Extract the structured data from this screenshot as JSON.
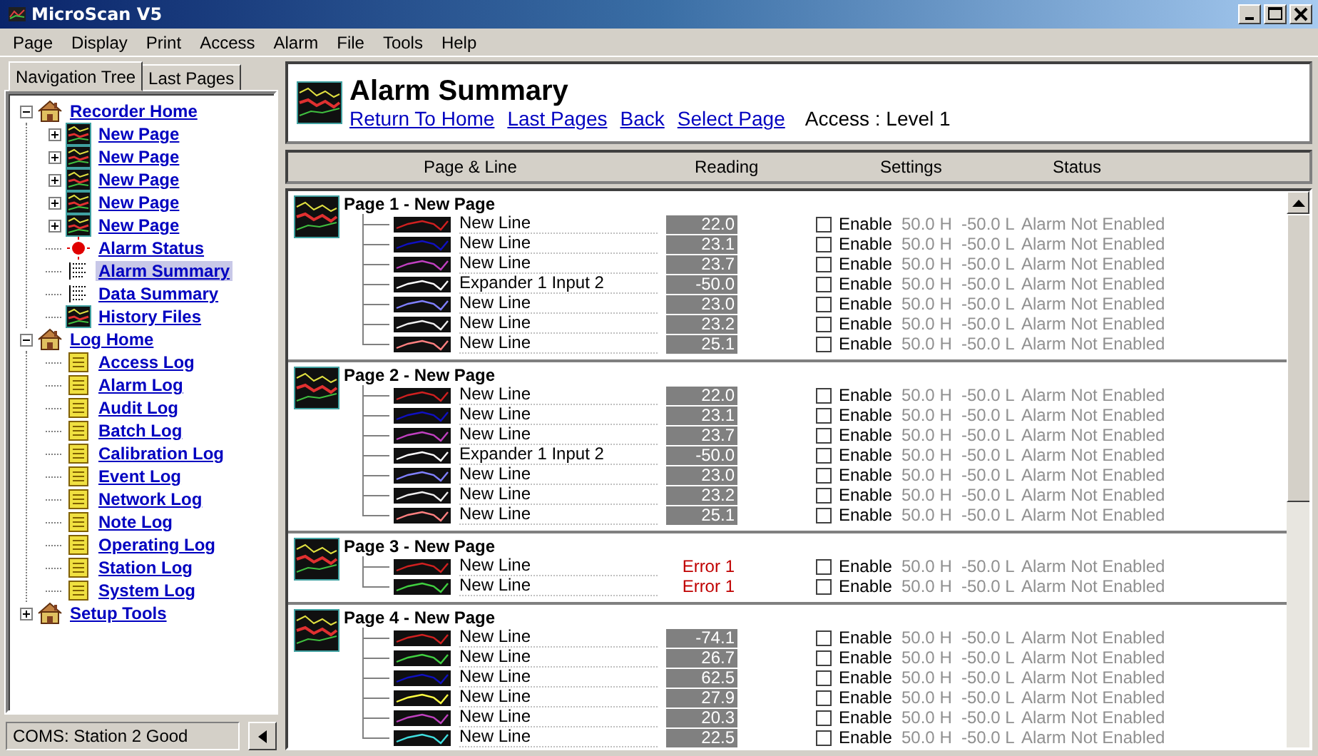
{
  "window": {
    "title": "MicroScan V5"
  },
  "menu": [
    "Page",
    "Display",
    "Print",
    "Access",
    "Alarm",
    "File",
    "Tools",
    "Help"
  ],
  "nav_tabs": [
    {
      "label": "Navigation Tree",
      "selected": true
    },
    {
      "label": "Last Pages",
      "selected": false
    }
  ],
  "tree": [
    {
      "label": "Recorder Home",
      "kind": "home",
      "expanded": true,
      "selected": false,
      "children": [
        {
          "label": "New Page",
          "kind": "page",
          "expanded": false,
          "selected": false
        },
        {
          "label": "New Page",
          "kind": "page",
          "expanded": false,
          "selected": false
        },
        {
          "label": "New Page",
          "kind": "page",
          "expanded": false,
          "selected": false
        },
        {
          "label": "New Page",
          "kind": "page",
          "expanded": false,
          "selected": false
        },
        {
          "label": "New Page",
          "kind": "page",
          "expanded": false,
          "selected": false
        },
        {
          "label": "Alarm Status",
          "kind": "alarm",
          "selected": false
        },
        {
          "label": "Alarm Summary",
          "kind": "summary",
          "selected": true
        },
        {
          "label": "Data Summary",
          "kind": "summary",
          "selected": false
        },
        {
          "label": "History Files",
          "kind": "page",
          "selected": false
        }
      ]
    },
    {
      "label": "Log Home",
      "kind": "home",
      "expanded": true,
      "selected": false,
      "children": [
        {
          "label": "Access Log",
          "kind": "log",
          "selected": false
        },
        {
          "label": "Alarm Log",
          "kind": "log",
          "selected": false
        },
        {
          "label": "Audit Log",
          "kind": "log",
          "selected": false
        },
        {
          "label": "Batch Log",
          "kind": "log",
          "selected": false
        },
        {
          "label": "Calibration Log",
          "kind": "log",
          "selected": false
        },
        {
          "label": "Event Log",
          "kind": "log",
          "selected": false
        },
        {
          "label": "Network Log",
          "kind": "log",
          "selected": false
        },
        {
          "label": "Note Log",
          "kind": "log",
          "selected": false
        },
        {
          "label": "Operating Log",
          "kind": "log",
          "selected": false
        },
        {
          "label": "Station Log",
          "kind": "log",
          "selected": false
        },
        {
          "label": "System Log",
          "kind": "log",
          "selected": false
        }
      ]
    },
    {
      "label": "Setup Tools",
      "kind": "home",
      "expanded": false,
      "selected": false
    }
  ],
  "status_bar": {
    "text": "COMS: Station 2 Good"
  },
  "header": {
    "title": "Alarm Summary",
    "links": [
      "Return To Home",
      "Last Pages",
      "Back",
      "Select Page"
    ],
    "access": "Access : Level 1"
  },
  "columns": [
    "Page & Line",
    "Reading",
    "Settings",
    "Status"
  ],
  "groups": [
    {
      "title": "Page 1 - New Page",
      "lines": [
        {
          "name": "New Line",
          "color": "#d02020",
          "kind": "value",
          "reading": "22.0",
          "enable": "Enable",
          "checked": false,
          "high": "50.0 H",
          "low": "-50.0 L",
          "status": "Alarm Not Enabled"
        },
        {
          "name": "New Line",
          "color": "#1010c0",
          "kind": "value",
          "reading": "23.1",
          "enable": "Enable",
          "checked": false,
          "high": "50.0 H",
          "low": "-50.0 L",
          "status": "Alarm Not Enabled"
        },
        {
          "name": "New Line",
          "color": "#c040c0",
          "kind": "value",
          "reading": "23.7",
          "enable": "Enable",
          "checked": false,
          "high": "50.0 H",
          "low": "-50.0 L",
          "status": "Alarm Not Enabled"
        },
        {
          "name": "Expander 1 Input 2",
          "color": "#ffffff",
          "kind": "value",
          "reading": "-50.0",
          "enable": "Enable",
          "checked": false,
          "high": "50.0 H",
          "low": "-50.0 L",
          "status": "Alarm Not Enabled"
        },
        {
          "name": "New Line",
          "color": "#8080ff",
          "kind": "value",
          "reading": "23.0",
          "enable": "Enable",
          "checked": false,
          "high": "50.0 H",
          "low": "-50.0 L",
          "status": "Alarm Not Enabled"
        },
        {
          "name": "New Line",
          "color": "#f0f0f0",
          "kind": "value",
          "reading": "23.2",
          "enable": "Enable",
          "checked": false,
          "high": "50.0 H",
          "low": "-50.0 L",
          "status": "Alarm Not Enabled"
        },
        {
          "name": "New Line",
          "color": "#ff8080",
          "kind": "value",
          "reading": "25.1",
          "enable": "Enable",
          "checked": false,
          "high": "50.0 H",
          "low": "-50.0 L",
          "status": "Alarm Not Enabled"
        }
      ]
    },
    {
      "title": "Page 2 - New Page",
      "lines": [
        {
          "name": "New Line",
          "color": "#d02020",
          "kind": "value",
          "reading": "22.0",
          "enable": "Enable",
          "checked": false,
          "high": "50.0 H",
          "low": "-50.0 L",
          "status": "Alarm Not Enabled"
        },
        {
          "name": "New Line",
          "color": "#1010c0",
          "kind": "value",
          "reading": "23.1",
          "enable": "Enable",
          "checked": false,
          "high": "50.0 H",
          "low": "-50.0 L",
          "status": "Alarm Not Enabled"
        },
        {
          "name": "New Line",
          "color": "#c040c0",
          "kind": "value",
          "reading": "23.7",
          "enable": "Enable",
          "checked": false,
          "high": "50.0 H",
          "low": "-50.0 L",
          "status": "Alarm Not Enabled"
        },
        {
          "name": "Expander 1 Input 2",
          "color": "#ffffff",
          "kind": "value",
          "reading": "-50.0",
          "enable": "Enable",
          "checked": false,
          "high": "50.0 H",
          "low": "-50.0 L",
          "status": "Alarm Not Enabled"
        },
        {
          "name": "New Line",
          "color": "#8080ff",
          "kind": "value",
          "reading": "23.0",
          "enable": "Enable",
          "checked": false,
          "high": "50.0 H",
          "low": "-50.0 L",
          "status": "Alarm Not Enabled"
        },
        {
          "name": "New Line",
          "color": "#f0f0f0",
          "kind": "value",
          "reading": "23.2",
          "enable": "Enable",
          "checked": false,
          "high": "50.0 H",
          "low": "-50.0 L",
          "status": "Alarm Not Enabled"
        },
        {
          "name": "New Line",
          "color": "#ff8080",
          "kind": "value",
          "reading": "25.1",
          "enable": "Enable",
          "checked": false,
          "high": "50.0 H",
          "low": "-50.0 L",
          "status": "Alarm Not Enabled"
        }
      ]
    },
    {
      "title": "Page 3 - New Page",
      "lines": [
        {
          "name": "New Line",
          "color": "#d02020",
          "kind": "error",
          "reading": "Error 1",
          "enable": "Enable",
          "checked": false,
          "high": "50.0 H",
          "low": "-50.0 L",
          "status": "Alarm Not Enabled"
        },
        {
          "name": "New Line",
          "color": "#40d040",
          "kind": "error",
          "reading": "Error 1",
          "enable": "Enable",
          "checked": false,
          "high": "50.0 H",
          "low": "-50.0 L",
          "status": "Alarm Not Enabled"
        }
      ]
    },
    {
      "title": "Page 4 - New Page",
      "lines": [
        {
          "name": "New Line",
          "color": "#d02020",
          "kind": "value",
          "reading": "-74.1",
          "enable": "Enable",
          "checked": false,
          "high": "50.0 H",
          "low": "-50.0 L",
          "status": "Alarm Not Enabled"
        },
        {
          "name": "New Line",
          "color": "#40d040",
          "kind": "value",
          "reading": "26.7",
          "enable": "Enable",
          "checked": false,
          "high": "50.0 H",
          "low": "-50.0 L",
          "status": "Alarm Not Enabled"
        },
        {
          "name": "New Line",
          "color": "#1010c0",
          "kind": "value",
          "reading": "62.5",
          "enable": "Enable",
          "checked": false,
          "high": "50.0 H",
          "low": "-50.0 L",
          "status": "Alarm Not Enabled"
        },
        {
          "name": "New Line",
          "color": "#ffff40",
          "kind": "value",
          "reading": "27.9",
          "enable": "Enable",
          "checked": false,
          "high": "50.0 H",
          "low": "-50.0 L",
          "status": "Alarm Not Enabled"
        },
        {
          "name": "New Line",
          "color": "#c040c0",
          "kind": "value",
          "reading": "20.3",
          "enable": "Enable",
          "checked": false,
          "high": "50.0 H",
          "low": "-50.0 L",
          "status": "Alarm Not Enabled"
        },
        {
          "name": "New Line",
          "color": "#40e0e0",
          "kind": "value",
          "reading": "22.5",
          "enable": "Enable",
          "checked": false,
          "high": "50.0 H",
          "low": "-50.0 L",
          "status": "Alarm Not Enabled"
        }
      ]
    }
  ]
}
